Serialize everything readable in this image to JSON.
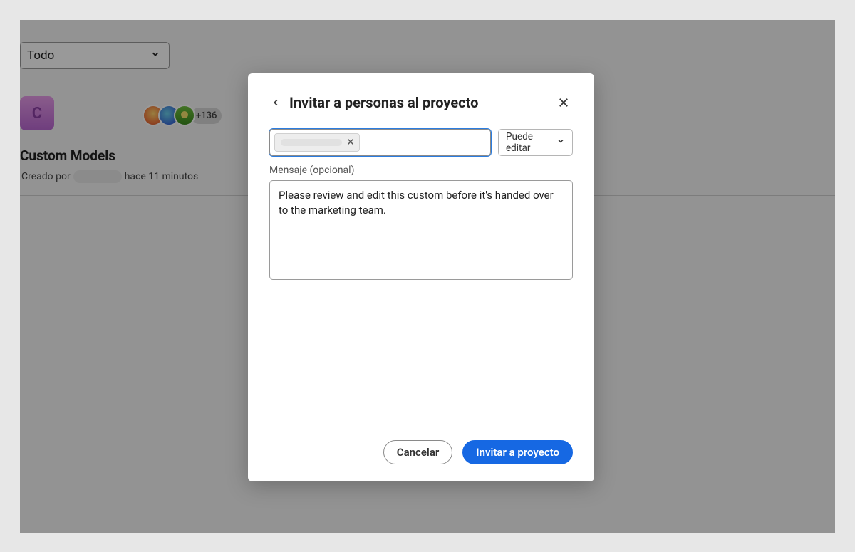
{
  "background": {
    "filter_label": "Todo",
    "project": {
      "tile_letter": "C",
      "title": "Custom Models",
      "created_by_prefix": "Creado por",
      "created_time": "hace 11 minutos",
      "more_count": "+136"
    }
  },
  "modal": {
    "title": "Invitar a personas al proyecto",
    "permission_label": "Puede editar",
    "message_label": "Mensaje (opcional)",
    "message_value": "Please review and edit this custom before it's handed over to the marketing team.",
    "cancel_label": "Cancelar",
    "invite_label": "Invitar a proyecto"
  }
}
